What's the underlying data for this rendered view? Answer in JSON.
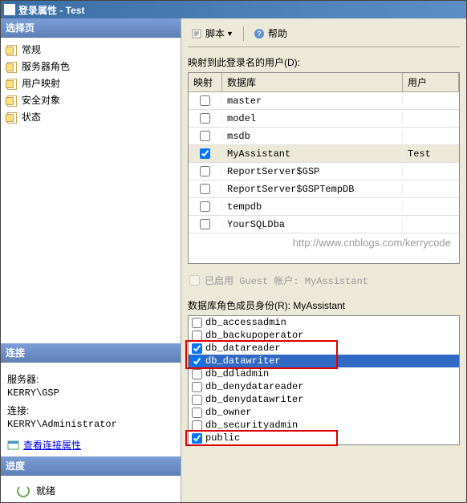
{
  "title": "登录属性 - Test",
  "sidebar": {
    "select_header": "选择页",
    "items": [
      {
        "label": "常规"
      },
      {
        "label": "服务器角色"
      },
      {
        "label": "用户映射"
      },
      {
        "label": "安全对象"
      },
      {
        "label": "状态"
      }
    ],
    "connect_header": "连接",
    "server_label": "服务器:",
    "server_value": "KERRY\\GSP",
    "conn_label": "连接:",
    "conn_value": "KERRY\\Administrator",
    "view_conn_link": "查看连接属性",
    "progress_header": "进度",
    "progress_status": "就绪"
  },
  "toolbar": {
    "script_label": "脚本",
    "help_label": "帮助"
  },
  "mapping": {
    "label": "映射到此登录名的用户(D):",
    "headers": {
      "map": "映射",
      "db": "数据库",
      "user": "用户"
    },
    "rows": [
      {
        "checked": false,
        "db": "master",
        "user": ""
      },
      {
        "checked": false,
        "db": "model",
        "user": ""
      },
      {
        "checked": false,
        "db": "msdb",
        "user": ""
      },
      {
        "checked": true,
        "db": "MyAssistant",
        "user": "Test",
        "selected": true
      },
      {
        "checked": false,
        "db": "ReportServer$GSP",
        "user": ""
      },
      {
        "checked": false,
        "db": "ReportServer$GSPTempDB",
        "user": ""
      },
      {
        "checked": false,
        "db": "tempdb",
        "user": ""
      },
      {
        "checked": false,
        "db": "YourSQLDba",
        "user": ""
      }
    ],
    "hint_url": "http://www.cnblogs.com/kerrycode"
  },
  "guest": {
    "label": "已启用 Guest 帐户: MyAssistant"
  },
  "roles": {
    "label": "数据库角色成员身份(R): MyAssistant",
    "items": [
      {
        "checked": false,
        "name": "db_accessadmin"
      },
      {
        "checked": false,
        "name": "db_backupoperator"
      },
      {
        "checked": true,
        "name": "db_datareader"
      },
      {
        "checked": true,
        "name": "db_datawriter",
        "selected": true
      },
      {
        "checked": false,
        "name": "db_ddladmin"
      },
      {
        "checked": false,
        "name": "db_denydatareader"
      },
      {
        "checked": false,
        "name": "db_denydatawriter"
      },
      {
        "checked": false,
        "name": "db_owner"
      },
      {
        "checked": false,
        "name": "db_securityadmin"
      },
      {
        "checked": true,
        "name": "public"
      }
    ]
  }
}
